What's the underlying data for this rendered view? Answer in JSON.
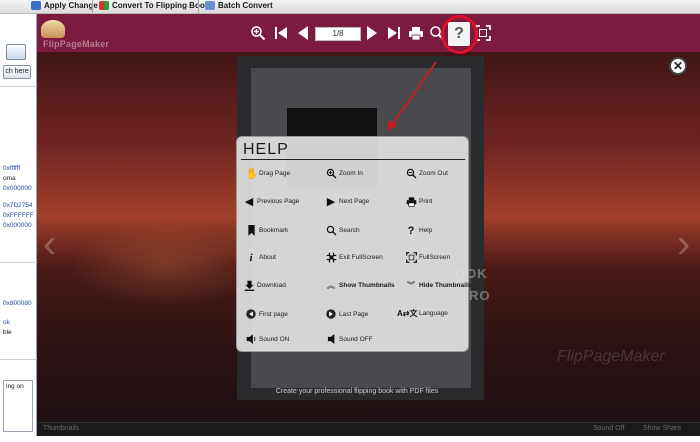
{
  "app_toolbar": {
    "buttons": [
      "Apply Change",
      "Convert To Flipping Book",
      "Batch Convert"
    ]
  },
  "left_panel": {
    "button_label": "ch here",
    "values": [
      "0xffffff",
      "oma",
      "0x000000",
      "0x7D2754",
      "0xFFFFFF",
      "0x000000",
      "0x800080",
      "ok",
      "ble",
      "ing on"
    ]
  },
  "viewer": {
    "logo_text": "FlipPageMaker",
    "page_indicator": "1/8",
    "page_caption": "Create your professional flipping book with PDF files",
    "page_overlay_1": "OOK",
    "page_overlay_2": "RO",
    "bottom_left": "Thumbnails",
    "bottom_right_1": "Sound Off",
    "bottom_right_2": "Show Share",
    "watermark": "FlipPageMaker"
  },
  "toolbar_icons": [
    "zoom-in-icon",
    "first-page-icon",
    "previous-page-icon",
    "next-page-icon",
    "last-page-icon",
    "print-icon",
    "search-icon",
    "help-icon",
    "fullscreen-icon"
  ],
  "help": {
    "title": "HELP",
    "items": [
      {
        "label": "Drag Page",
        "icon": "hand-icon"
      },
      {
        "label": "Zoom In",
        "icon": "zoom-in-icon"
      },
      {
        "label": "Zoom Out",
        "icon": "zoom-out-icon"
      },
      {
        "label": "Previous Page",
        "icon": "previous-icon"
      },
      {
        "label": "Next Page",
        "icon": "next-icon"
      },
      {
        "label": "Print",
        "icon": "print-icon"
      },
      {
        "label": "Bookmark",
        "icon": "bookmark-icon"
      },
      {
        "label": "Search",
        "icon": "search-icon"
      },
      {
        "label": "Help",
        "icon": "help-icon"
      },
      {
        "label": "About",
        "icon": "info-icon"
      },
      {
        "label": "Exit FullScreen",
        "icon": "exit-fullscreen-icon"
      },
      {
        "label": "FullScreen",
        "icon": "fullscreen-icon"
      },
      {
        "label": "Download",
        "icon": "download-icon"
      },
      {
        "label": "Show Thumbnails",
        "icon": "show-thumbnails-icon"
      },
      {
        "label": "Hide Thumbnails",
        "icon": "hide-thumbnails-icon"
      },
      {
        "label": "First page",
        "icon": "first-page-icon"
      },
      {
        "label": "Last Page",
        "icon": "last-page-icon"
      },
      {
        "label": "Language",
        "icon": "language-icon"
      },
      {
        "label": "Sound ON",
        "icon": "sound-on-icon"
      },
      {
        "label": "Sound OFF",
        "icon": "sound-off-icon"
      }
    ]
  },
  "colors": {
    "viewer_bar": "#7d1a3f",
    "highlight_ring": "#e0102a"
  }
}
